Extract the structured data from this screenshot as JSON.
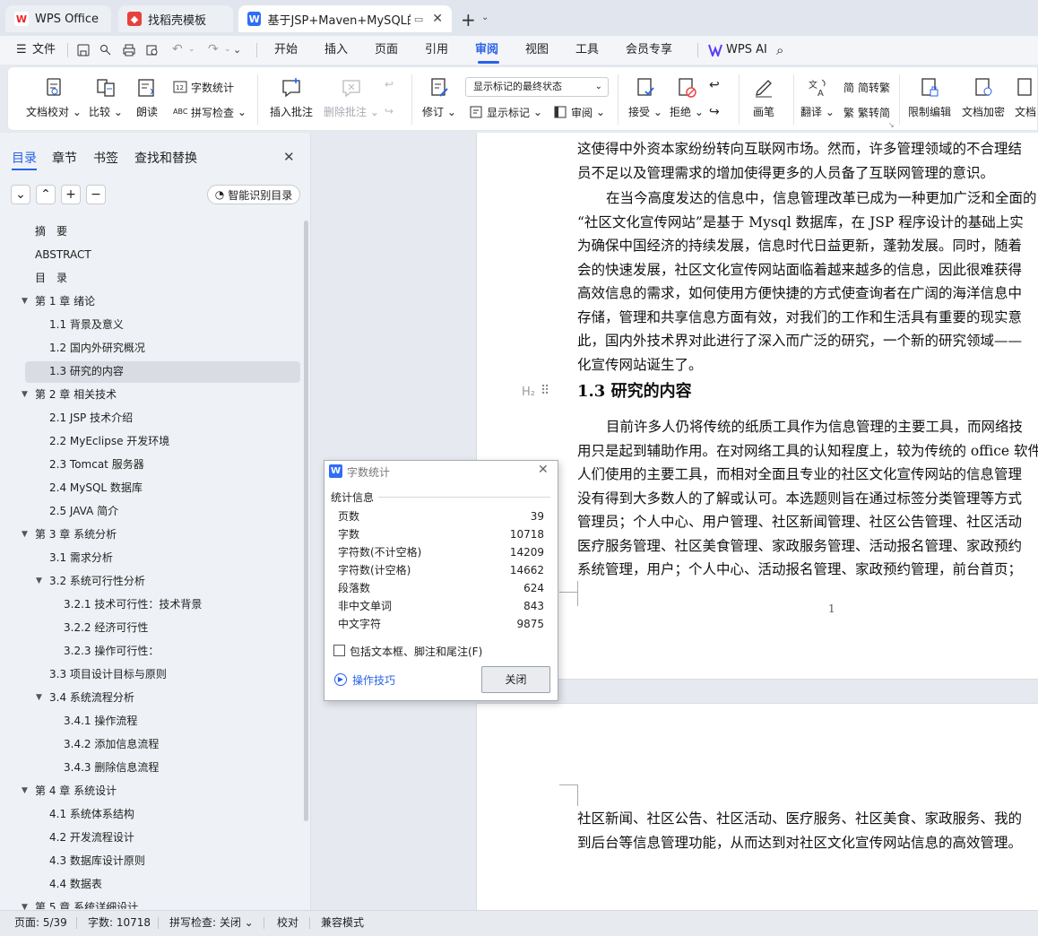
{
  "tabs": {
    "wps": "WPS Office",
    "template": "找稻壳模板",
    "doc": "基于JSP+Maven+MySQL的社"
  },
  "menu": {
    "file": "文件",
    "start": "开始",
    "insert": "插入",
    "page": "页面",
    "ref": "引用",
    "review": "审阅",
    "view": "视图",
    "tools": "工具",
    "member": "会员专享",
    "ai": "WPS AI"
  },
  "ribbon": {
    "proof": "文档校对",
    "compare": "比较",
    "read": "朗读",
    "wordcount": "字数统计",
    "spell": "拼写检查",
    "insert_comment": "插入批注",
    "delete_comment": "删除批注",
    "revise": "修订",
    "markup_dropdown": "显示标记的最终状态",
    "show_markup": "显示标记",
    "review_pane": "审阅",
    "accept": "接受",
    "reject": "拒绝",
    "pen": "画笔",
    "translate": "翻译",
    "to_trad": "简转繁",
    "to_simp": "繁转简",
    "restrict": "限制编辑",
    "encrypt": "文档加密",
    "doc_more": "文档"
  },
  "panel": {
    "tab_toc": "目录",
    "tab_chapter": "章节",
    "tab_bookmark": "书签",
    "tab_find": "查找和替换",
    "smart": "智能识别目录"
  },
  "toc": [
    {
      "label": "摘　要"
    },
    {
      "label": "ABSTRACT"
    },
    {
      "label": "目　录"
    },
    {
      "label": "第 1 章  绪论"
    },
    {
      "label": "1.1 背景及意义"
    },
    {
      "label": "1.2  国内外研究概况"
    },
    {
      "label": "1.3  研究的内容"
    },
    {
      "label": "第 2 章  相关技术"
    },
    {
      "label": "2.1 JSP 技术介绍"
    },
    {
      "label": "2.2 MyEclipse 开发环境"
    },
    {
      "label": "2.3 Tomcat 服务器"
    },
    {
      "label": "2.4 MySQL 数据库"
    },
    {
      "label": "2.5 JAVA 简介"
    },
    {
      "label": "第 3 章  系统分析"
    },
    {
      "label": "3.1  需求分析"
    },
    {
      "label": "3.2  系统可行性分析"
    },
    {
      "label": "3.2.1 技术可行性：技术背景"
    },
    {
      "label": "3.2.2 经济可行性"
    },
    {
      "label": "3.2.3 操作可行性："
    },
    {
      "label": "3.3  项目设计目标与原则"
    },
    {
      "label": "3.4 系统流程分析"
    },
    {
      "label": "3.4.1 操作流程"
    },
    {
      "label": "3.4.2 添加信息流程"
    },
    {
      "label": "3.4.3 删除信息流程"
    },
    {
      "label": "第 4 章  系统设计"
    },
    {
      "label": "4.1  系统体系结构"
    },
    {
      "label": "4.2 开发流程设计"
    },
    {
      "label": "4.3  数据库设计原则"
    },
    {
      "label": "4.4  数据表"
    },
    {
      "label": "第 5 章  系统详细设计"
    }
  ],
  "doc": {
    "p1": [
      "这使得中外资本家纷纷转向互联网市场。然而，许多管理领域的不合理结",
      "员不足以及管理需求的增加使得更多的人员备了互联网管理的意识。"
    ],
    "p2": [
      "在当今高度发达的信息中，信息管理改革已成为一种更加广泛和全面的",
      "“社区文化宣传网站”是基于 Mysql 数据库，在 JSP 程序设计的基础上实",
      "为确保中国经济的持续发展，信息时代日益更新，蓬勃发展。同时，随着",
      "会的快速发展，社区文化宣传网站面临着越来越多的信息，因此很难获得",
      "高效信息的需求，如何使用方便快捷的方式使查询者在广阔的海洋信息中",
      "存储，管理和共享信息方面有效，对我们的工作和生活具有重要的现实意",
      "此，国内外技术界对此进行了深入而广泛的研究，一个新的研究领域——",
      "化宣传网站诞生了。"
    ],
    "heading": "1.3  研究的内容",
    "heading_tag": "H₂",
    "p3": [
      "目前许多人仍将传统的纸质工具作为信息管理的主要工具，而网络技",
      "用只是起到辅助作用。在对网络工具的认知程度上，较为传统的 office 软件",
      "人们使用的主要工具，而相对全面且专业的社区文化宣传网站的信息管理",
      "没有得到大多数人的了解或认可。本选题则旨在通过标签分类管理等方式",
      "管理员；个人中心、用户管理、社区新闻管理、社区公告管理、社区活动",
      "医疗服务管理、社区美食管理、家政服务管理、活动报名管理、家政预约",
      "系统管理，用户；个人中心、活动报名管理、家政预约管理，前台首页；"
    ],
    "page_num": "1",
    "p4": [
      "社区新闻、社区公告、社区活动、医疗服务、社区美食、家政服务、我的",
      "到后台等信息管理功能，从而达到对社区文化宣传网站信息的高效管理。"
    ]
  },
  "dialog": {
    "title": "字数统计",
    "section": "统计信息",
    "rows": [
      {
        "k": "页数",
        "v": "39"
      },
      {
        "k": "字数",
        "v": "10718"
      },
      {
        "k": "字符数(不计空格)",
        "v": "14209"
      },
      {
        "k": "字符数(计空格)",
        "v": "14662"
      },
      {
        "k": "段落数",
        "v": "624"
      },
      {
        "k": "非中文单词",
        "v": "843"
      },
      {
        "k": "中文字符",
        "v": "9875"
      }
    ],
    "include": "包括文本框、脚注和尾注(F)",
    "tips": "操作技巧",
    "close": "关闭"
  },
  "status": {
    "page": "页面: 5/39",
    "words": "字数: 10718",
    "spell": "拼写检查: 关闭",
    "proof": "校对",
    "compat": "兼容模式"
  }
}
